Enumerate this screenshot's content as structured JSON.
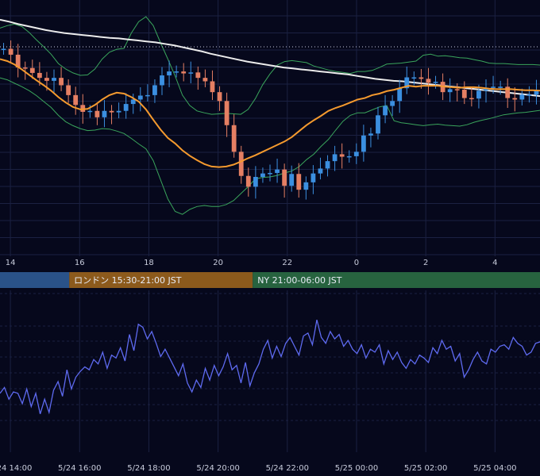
{
  "colors": {
    "background": "#06081c",
    "grid": "#1b2142",
    "up_candle": "#3b8fe0",
    "down_candle": "#e57f63",
    "ma_short": "#f59a2e",
    "ma_long": "#ececec",
    "bollinger": "#3aa55c",
    "oscillator": "#5e6af0",
    "session_tokyo": "#2a5288",
    "session_london": "#8c5a1c",
    "session_ny": "#27633f"
  },
  "price_axis": {
    "tick_labels": [
      "14",
      "16",
      "18",
      "20",
      "22",
      "0",
      "2",
      "4"
    ],
    "tick_hours": [
      14,
      16,
      18,
      20,
      22,
      24,
      26,
      28
    ],
    "x_range_hours": [
      13.7,
      29.3
    ]
  },
  "sessions": [
    {
      "name": "tokyo",
      "label": "",
      "start": 13.7,
      "end": 15.7,
      "color_key": "session_tokyo"
    },
    {
      "name": "london",
      "label": "ロンドン 15:30-21:00 JST",
      "start": 15.7,
      "end": 21.0,
      "color_key": "session_london"
    },
    {
      "name": "ny",
      "label": "NY 21:00-06:00 JST",
      "start": 21.0,
      "end": 29.3,
      "color_key": "session_ny"
    }
  ],
  "oscillator_axis": {
    "tick_labels": [
      "5/24 14:00",
      "5/24 16:00",
      "5/24 18:00",
      "5/24 20:00",
      "5/24 22:00",
      "5/25 00:00",
      "5/25 02:00",
      "5/25 04:00"
    ],
    "tick_hours": [
      14,
      16,
      18,
      20,
      22,
      24,
      26,
      28
    ]
  },
  "chart_data": {
    "type": "line",
    "x_unit": "hour (JST, 24 = 5/25 00:00)",
    "candles": {
      "close": [
        94.1,
        92.9,
        90.3,
        90.2,
        89.2,
        88.2,
        87.6,
        88.2,
        86.7,
        84.7,
        82.7,
        81.3,
        81.5,
        80.2,
        81.5,
        81.2,
        81.5,
        82.9,
        83.8,
        84.6,
        84.7,
        86.7,
        88.7,
        89.5,
        89.5,
        89.1,
        89.3,
        88.2,
        87.5,
        85.3,
        83.5,
        78.6,
        73.2,
        68.3,
        66.1,
        68.1,
        68.8,
        68.9,
        69.6,
        66.3,
        68.7,
        65.5,
        67.0,
        68.8,
        69.8,
        71.3,
        72.7,
        72.2,
        72.3,
        73.2,
        76.5,
        76.9,
        80.6,
        82.5,
        83.5,
        86.1,
        88.3,
        88.3,
        88.0,
        87.2,
        87.4,
        85.3,
        85.9,
        85.8,
        84.1,
        84.0,
        85.6,
        86.2,
        86.4,
        86.4,
        84.1,
        83.8,
        84.8,
        84.8,
        85.6
      ],
      "open": [
        94.1,
        94.1,
        92.9,
        90.3,
        90.2,
        89.2,
        88.2,
        87.6,
        88.2,
        86.7,
        84.7,
        82.7,
        81.3,
        81.5,
        80.2,
        81.5,
        81.2,
        81.5,
        82.9,
        83.8,
        84.6,
        84.7,
        86.7,
        88.7,
        89.5,
        89.5,
        89.1,
        89.3,
        88.2,
        87.5,
        85.3,
        83.5,
        78.6,
        73.2,
        68.3,
        66.1,
        68.1,
        68.8,
        68.9,
        69.6,
        66.3,
        68.7,
        65.5,
        67.0,
        68.8,
        69.8,
        71.3,
        72.7,
        72.2,
        72.3,
        73.2,
        76.5,
        76.9,
        80.6,
        82.5,
        83.5,
        86.1,
        88.3,
        88.3,
        88.0,
        87.2,
        87.4,
        85.3,
        85.9,
        85.8,
        84.1,
        84.0,
        85.6,
        86.2,
        86.4,
        86.4,
        84.1,
        83.8,
        84.8,
        84.8
      ]
    },
    "ma_short": [
      92.0,
      91.6,
      90.9,
      89.9,
      88.8,
      87.7,
      86.7,
      85.6,
      84.3,
      83.2,
      82.3,
      81.8,
      81.9,
      82.7,
      83.8,
      84.7,
      85.2,
      85.0,
      84.3,
      83.4,
      81.8,
      79.7,
      77.7,
      76.0,
      74.9,
      73.5,
      72.4,
      71.5,
      70.7,
      70.2,
      70.1,
      70.2,
      70.6,
      71.2,
      71.9,
      72.5,
      73.2,
      73.9,
      74.6,
      75.3,
      76.2,
      77.4,
      78.6,
      79.6,
      80.5,
      81.5,
      82.1,
      82.6,
      83.2,
      83.8,
      84.1,
      84.7,
      85.0,
      85.5,
      85.8,
      86.2,
      86.6,
      86.4,
      86.6,
      86.6,
      86.6,
      86.4,
      86.3,
      86.2,
      86.3,
      86.3,
      86.2,
      86.0,
      85.9,
      85.9,
      85.9,
      85.8,
      85.7,
      85.7,
      85.6
    ],
    "ma_long": [
      100.0,
      99.6,
      99.1,
      98.7,
      98.3,
      97.9,
      97.6,
      97.3,
      97.1,
      96.9,
      96.7,
      96.5,
      96.3,
      96.2,
      96.0,
      95.8,
      95.6,
      95.4,
      95.1,
      94.8,
      94.4,
      94.0,
      93.6,
      93.1,
      92.7,
      92.3,
      91.9,
      91.5,
      91.2,
      90.9,
      90.6,
      90.3,
      90.1,
      89.9,
      89.7,
      89.5,
      89.3,
      89.1,
      88.9,
      88.6,
      88.3,
      88.0,
      87.8,
      87.6,
      87.5,
      87.3,
      87.1,
      86.9,
      86.7,
      86.5,
      86.3,
      86.1,
      85.9,
      85.7,
      85.5,
      85.3,
      85.1,
      84.9,
      84.7,
      84.5
    ],
    "bollinger_upper": [
      98.3,
      98.8,
      99.1,
      98.6,
      97.4,
      95.9,
      94.5,
      93.0,
      91.1,
      90.0,
      89.2,
      88.7,
      88.8,
      90.0,
      92.0,
      93.4,
      94.0,
      94.2,
      97.3,
      99.6,
      100.6,
      98.8,
      95.3,
      92.0,
      88.6,
      84.7,
      82.6,
      81.5,
      81.1,
      80.8,
      80.9,
      81.0,
      80.9,
      80.8,
      81.8,
      84.0,
      86.8,
      89.0,
      90.8,
      91.5,
      91.7,
      91.5,
      91.3,
      90.6,
      90.2,
      89.8,
      89.5,
      89.3,
      89.1,
      89.5,
      89.5,
      89.7,
      90.3,
      91.0,
      91.1,
      91.2,
      91.4,
      91.6,
      92.8,
      93.0,
      92.6,
      92.7,
      92.5,
      92.3,
      92.2,
      91.9,
      91.6,
      91.2,
      91.1,
      91.1,
      91.0,
      90.9,
      90.9,
      90.9,
      90.8
    ],
    "bollinger_lower": [
      88.2,
      87.8,
      87.1,
      86.4,
      85.6,
      84.6,
      83.4,
      82.2,
      80.6,
      79.3,
      78.5,
      77.9,
      77.5,
      77.6,
      77.9,
      77.8,
      77.4,
      76.9,
      75.9,
      74.8,
      73.8,
      71.4,
      67.5,
      63.6,
      61.1,
      60.5,
      61.5,
      62.1,
      62.3,
      62.1,
      62.1,
      62.5,
      63.3,
      64.7,
      66.1,
      67.7,
      68.0,
      68.1,
      68.4,
      68.9,
      69.3,
      70.2,
      71.6,
      72.7,
      74.3,
      75.7,
      77.6,
      79.4,
      80.6,
      81.1,
      81.1,
      81.7,
      82.3,
      82.6,
      79.5,
      79.1,
      78.9,
      78.7,
      78.5,
      78.7,
      78.8,
      78.6,
      78.5,
      78.4,
      78.7,
      79.2,
      79.6,
      79.9,
      80.3,
      80.7,
      80.9,
      81.1,
      81.2,
      81.4,
      81.6
    ],
    "oscillator": [
      40,
      44,
      36,
      41,
      40,
      33,
      43,
      31,
      40,
      26,
      36,
      27,
      42,
      48,
      38,
      56,
      43,
      51,
      55,
      58,
      56,
      63,
      60,
      68,
      57,
      66,
      64,
      71,
      62,
      80,
      69,
      87,
      85,
      77,
      82,
      74,
      65,
      70,
      64,
      58,
      52,
      60,
      47,
      41,
      49,
      44,
      57,
      49,
      59,
      52,
      58,
      67,
      56,
      59,
      47,
      61,
      45,
      54,
      60,
      70,
      76,
      64,
      72,
      65,
      74,
      78,
      72,
      66,
      79,
      81,
      73,
      90,
      78,
      74,
      82,
      77,
      80,
      72,
      76,
      70,
      67,
      73,
      64,
      70,
      68,
      73,
      60,
      69,
      63,
      68,
      61,
      57,
      63,
      60,
      66,
      64,
      61,
      71,
      67,
      76,
      70,
      72,
      62,
      67,
      51,
      56,
      63,
      68,
      62,
      60,
      70,
      68,
      72,
      73,
      70,
      78,
      74,
      72,
      66,
      68,
      74,
      75
    ],
    "reference_level_dotted": 94.5
  }
}
